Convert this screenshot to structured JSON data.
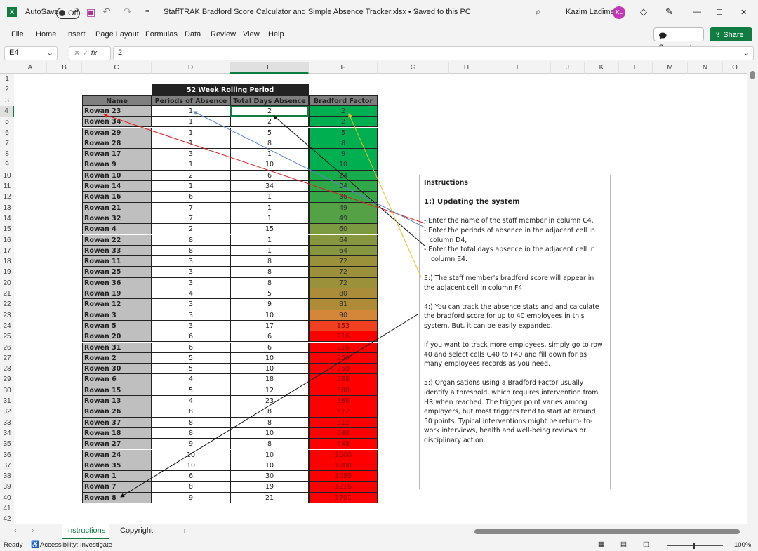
{
  "titlebar": {
    "autosave": "AutoSave",
    "autosave_state": "Off",
    "title": "StaffTRAK Bradford Score Calculator and Simple Absence Tracker.xlsx • Saved to this PC",
    "user": "Kazim Ladimeji",
    "initials": "KL"
  },
  "menu": [
    "File",
    "Home",
    "Insert",
    "Page Layout",
    "Formulas",
    "Data",
    "Review",
    "View",
    "Help"
  ],
  "comments": "Comments",
  "share": "Share",
  "formula": {
    "namebox": "E4",
    "fx": "fx",
    "value": "2"
  },
  "columns": [
    "A",
    "B",
    "C",
    "D",
    "E",
    "F",
    "G",
    "H",
    "I",
    "J",
    "K",
    "L",
    "M",
    "N",
    "O"
  ],
  "table": {
    "period_title": "52 Week Rolling Period",
    "headers": [
      "Name",
      "Periods of Absence",
      "Total Days Absence",
      "Bradford Factor"
    ],
    "rows": [
      [
        "Rowan 23",
        1,
        2,
        2
      ],
      [
        "Rowen 34",
        1,
        2,
        2
      ],
      [
        "Rowan 29",
        1,
        5,
        5
      ],
      [
        "Rowan 28",
        1,
        8,
        8
      ],
      [
        "Rowan 17",
        3,
        1,
        9
      ],
      [
        "Rowan 9",
        1,
        10,
        10
      ],
      [
        "Rowan 10",
        2,
        6,
        24
      ],
      [
        "Rowan 14",
        1,
        34,
        34
      ],
      [
        "Rowan 16",
        6,
        1,
        36
      ],
      [
        "Rowan 21",
        7,
        1,
        49
      ],
      [
        "Rowen 32",
        7,
        1,
        49
      ],
      [
        "Rowan 4",
        2,
        15,
        60
      ],
      [
        "Rowan 22",
        8,
        1,
        64
      ],
      [
        "Rowen 33",
        8,
        1,
        64
      ],
      [
        "Rowan 11",
        3,
        8,
        72
      ],
      [
        "Rowan 25",
        3,
        8,
        72
      ],
      [
        "Rowen 36",
        3,
        8,
        72
      ],
      [
        "Rowan 19",
        4,
        5,
        80
      ],
      [
        "Rowan 12",
        3,
        9,
        81
      ],
      [
        "Rowan 3",
        3,
        10,
        90
      ],
      [
        "Rowan 5",
        3,
        17,
        153
      ],
      [
        "Rowan 20",
        6,
        6,
        216
      ],
      [
        "Rowen 31",
        6,
        6,
        216
      ],
      [
        "Rowan 2",
        5,
        10,
        250
      ],
      [
        "Rowen 30",
        5,
        10,
        250
      ],
      [
        "Rowan 6",
        4,
        18,
        288
      ],
      [
        "Rowan 15",
        5,
        12,
        300
      ],
      [
        "Rowan 13",
        4,
        23,
        368
      ],
      [
        "Rowan 26",
        8,
        8,
        512
      ],
      [
        "Rowen 37",
        8,
        8,
        512
      ],
      [
        "Rowan 18",
        8,
        10,
        640
      ],
      [
        "Rowan 27",
        9,
        8,
        648
      ],
      [
        "Rowan 24",
        10,
        10,
        1000
      ],
      [
        "Rowen 35",
        10,
        10,
        1000
      ],
      [
        "Rowan 1",
        6,
        30,
        1080
      ],
      [
        "Rowan 7",
        8,
        19,
        1216
      ],
      [
        "Rowan 8",
        9,
        21,
        1701
      ]
    ],
    "factor_colors": [
      "#00b050",
      "#00b050",
      "#00b050",
      "#00b050",
      "#00b050",
      "#00b050",
      "#17ad4c",
      "#2fa84a",
      "#35a749",
      "#54a146",
      "#54a146",
      "#7c9a41",
      "#879740",
      "#879740",
      "#9c913b",
      "#9c913b",
      "#9c913b",
      "#ab8c38",
      "#ae8b37",
      "#d48639",
      "#f0401f",
      "#ff0000",
      "#ff0000",
      "#ff0000",
      "#ff0000",
      "#ff0000",
      "#ff0000",
      "#ff0000",
      "#ff0000",
      "#ff0000",
      "#ff0000",
      "#ff0000",
      "#ff0000",
      "#ff0000",
      "#ff0000",
      "#ff0000",
      "#ff0000"
    ]
  },
  "instructions": {
    "title": "Instructions",
    "h1": "1:) Updating the system",
    "b1": "- Enter the name of the staff member in column C4,",
    "b2": "- Enter the periods of absence in the adjacent cell in column D4,",
    "b3": "-  Enter the total days absence in the adjacent cell in column E4.",
    "s3": "3:) The staff member's  bradford score will appear in the adjacent cell in column F4",
    "s4": "4:)  You can track the absence stats and and calculate the bradford score for up to 40 employees in this system. But, it can be easily expanded.",
    "s4b": "If you want to track more employees, simply go to row 40 and select cells C40 to F40 and fill down for as many employees records as you need.",
    "s5": "5:) Organisations using a Bradford Factor usually identify a threshold, which requires intervention from HR when reached. The trigger point varies among employers, but most triggers tend to start at around 50 points.  Typical interventions might be return- to-work interviews, health and well-being reviews or disciplinary action."
  },
  "tabs": [
    "Instructions",
    "Copyright"
  ],
  "status": {
    "ready": "Ready",
    "accessibility": "Accessibility: Investigate",
    "zoom": "100%"
  }
}
